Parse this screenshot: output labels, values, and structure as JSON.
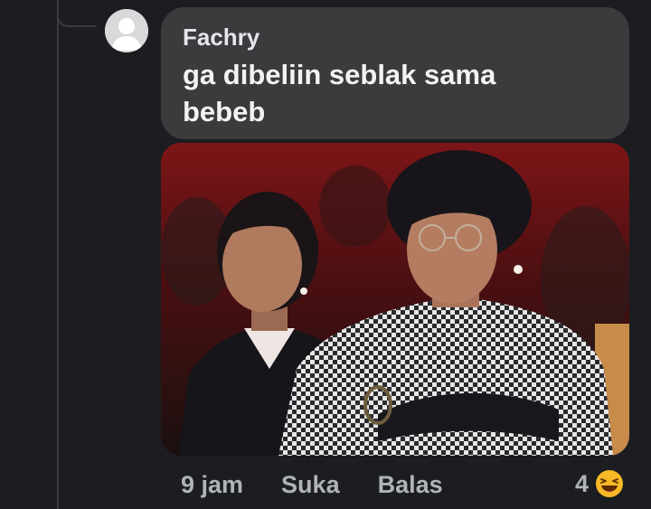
{
  "comment": {
    "author": "Fachry",
    "text": "ga dibeliin seblak sama bebeb",
    "attachment": "photo",
    "time": "9 jam",
    "like_label": "Suka",
    "reply_label": "Balas",
    "reaction_count": "4",
    "reaction_icon": "haha-emoji-icon"
  },
  "colors": {
    "background": "#1c1d20",
    "bubble": "#3a3b3c",
    "author_text": "#e4e6eb",
    "body_text": "#f2f3f5",
    "meta_text": "#b0b3b8",
    "reaction": "#f7b928"
  }
}
